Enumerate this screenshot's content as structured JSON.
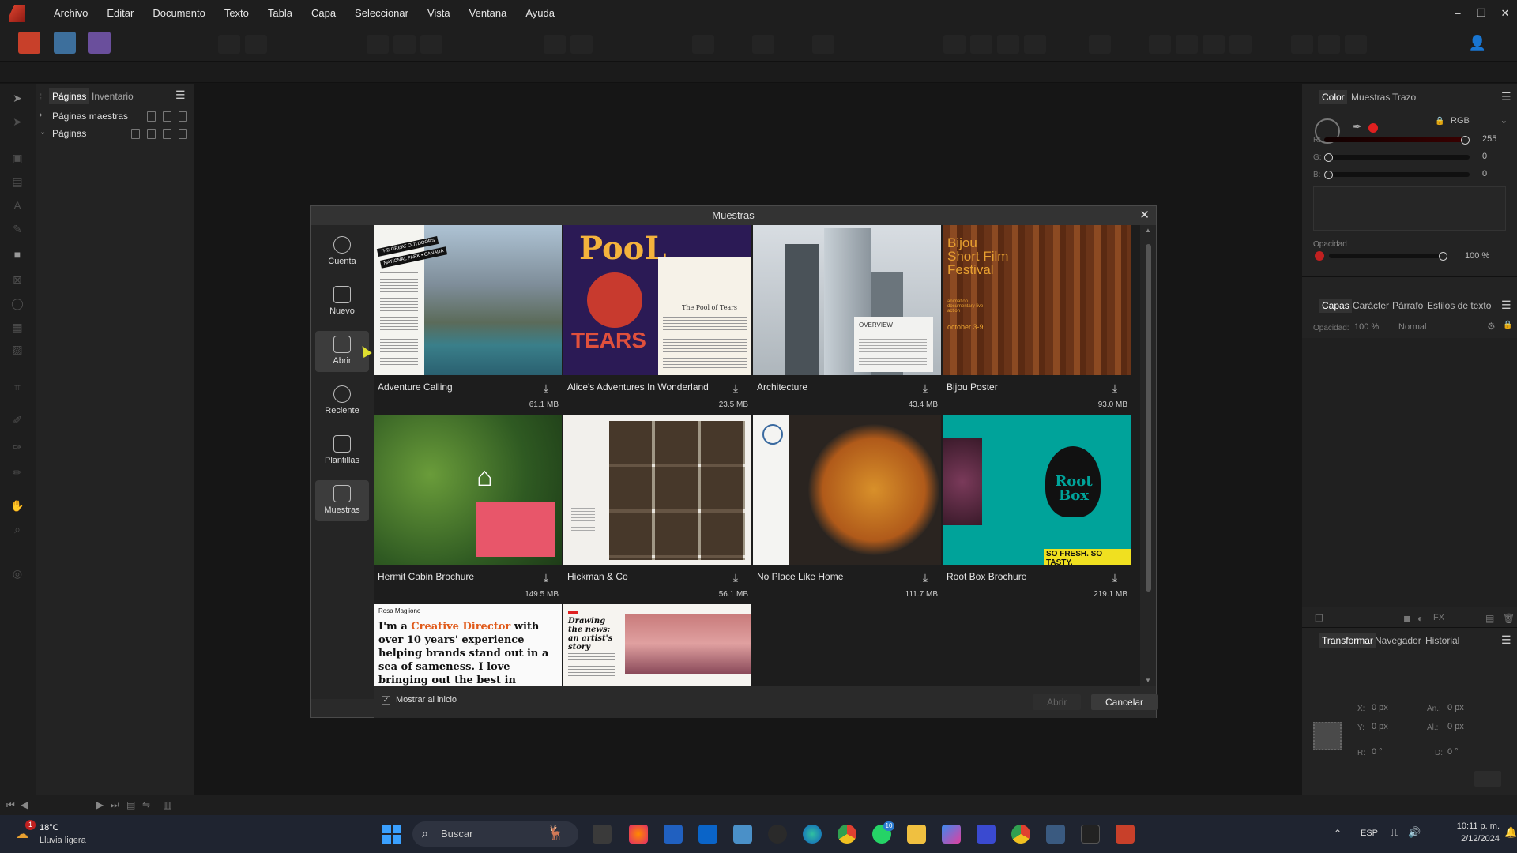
{
  "menu": [
    "Archivo",
    "Editar",
    "Documento",
    "Texto",
    "Tabla",
    "Capa",
    "Seleccionar",
    "Vista",
    "Ventana",
    "Ayuda"
  ],
  "window_controls": [
    "–",
    "❐",
    "✕"
  ],
  "pages_panel": {
    "tabs": [
      "Páginas",
      "Inventario"
    ],
    "rows": [
      "Páginas maestras",
      "Páginas"
    ]
  },
  "color_panel": {
    "tabs": [
      "Color",
      "Muestras",
      "Trazo"
    ],
    "model": "RGB",
    "r_label": "R:",
    "g_label": "G:",
    "b_label": "B:",
    "r": 255,
    "g": 0,
    "b": 0,
    "r_val": "255",
    "g_val": "0",
    "b_val": "0",
    "opacity_label": "Opacidad",
    "opacity": "100 %"
  },
  "layers_panel": {
    "tabs": [
      "Capas",
      "Carácter",
      "Párrafo",
      "Estilos de texto"
    ],
    "opacity_label": "Opacidad:",
    "opacity": "100 %",
    "blend": "Normal"
  },
  "transform_panel": {
    "tabs": [
      "Transformar",
      "Navegador",
      "Historial"
    ],
    "x_label": "X:",
    "y_label": "Y:",
    "w_label": "An.:",
    "h_label": "Al.:",
    "r_label": "R:",
    "s_label": "D:",
    "x": "0 px",
    "y": "0 px",
    "w": "0 px",
    "h": "0 px",
    "r": "0 °",
    "s": "0 °"
  },
  "dialog": {
    "title": "Muestras",
    "nav": [
      {
        "label": "Cuenta",
        "icon": "account-icon"
      },
      {
        "label": "Nuevo",
        "icon": "new-document-icon"
      },
      {
        "label": "Abrir",
        "icon": "open-folder-icon"
      },
      {
        "label": "Reciente",
        "icon": "clock-icon"
      },
      {
        "label": "Plantillas",
        "icon": "templates-icon"
      },
      {
        "label": "Muestras",
        "icon": "samples-icon"
      }
    ],
    "samples": [
      {
        "name": "Adventure Calling",
        "size": "61.1 MB"
      },
      {
        "name": "Alice's Adventures In Wonderland",
        "size": "23.5 MB"
      },
      {
        "name": "Architecture",
        "size": "43.4 MB"
      },
      {
        "name": "Bijou Poster",
        "size": "93.0 MB"
      },
      {
        "name": "Hermit Cabin Brochure",
        "size": "149.5 MB"
      },
      {
        "name": "Hickman & Co",
        "size": "56.1 MB"
      },
      {
        "name": "No Place Like Home",
        "size": "111.7 MB"
      },
      {
        "name": "Root Box Brochure",
        "size": "219.1 MB"
      }
    ],
    "thumb_text": {
      "adv_tag1": "THE GREAT OUTDOORS",
      "adv_tag2": "NATIONAL PARK • CANADA",
      "pool": "PooL",
      "tears": "TEARS",
      "pool_sub": "The Pool of Tears",
      "overview": "OVERVIEW",
      "bijou": "Bijou Short Film Festival",
      "bijou_sub": "animation documentary live action",
      "bijou_date": "october 3-9",
      "rootbox": "Root Box",
      "sofresh": "SO FRESH. SO TASTY.",
      "rosa": "Rosa Magliono",
      "creative_a": "I'm a ",
      "creative_b": "Creative Director",
      "creative_c": " with over 10 years' experience helping brands stand out in a sea of sameness. I love bringing out the best in creative teams",
      "drawing": "Drawing the news: an artist's story"
    },
    "show_on_start": "Mostrar al inicio",
    "open_btn": "Abrir",
    "cancel_btn": "Cancelar"
  },
  "taskbar": {
    "weather_temp": "18°C",
    "weather_desc": "Lluvia ligera",
    "weather_badge": "1",
    "search_placeholder": "Buscar",
    "lang": "ESP",
    "time": "10:11 p. m.",
    "date": "2/12/2024",
    "whatsapp_badge": "10"
  },
  "colors": {
    "accent": "#0a84ff",
    "red": "#e02020",
    "teal": "#00a39a",
    "brand": "#d0402a"
  }
}
